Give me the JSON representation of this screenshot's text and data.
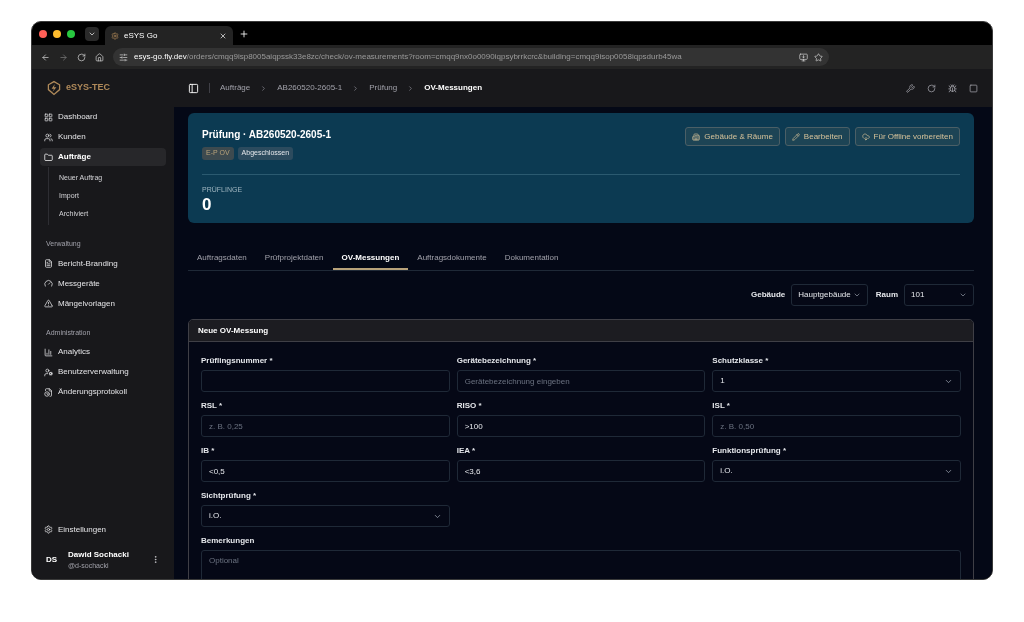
{
  "browser": {
    "tab_title": "eSYS Go",
    "url_host": "esys-go.fly.dev",
    "url_path": "/orders/cmqq9isp8005aiqpssk33e8zc/check/ov-measurements?room=cmqq9nx0o0090iqpsybrrkcrc&building=cmqq9isop0058iqpsdurb45wa"
  },
  "sidebar": {
    "logo": "eSYS-TEC",
    "items": [
      {
        "label": "Dashboard",
        "selected": false
      },
      {
        "label": "Kunden",
        "selected": false
      },
      {
        "label": "Aufträge",
        "selected": true,
        "children": [
          {
            "label": "Neuer Auftrag"
          },
          {
            "label": "Import"
          },
          {
            "label": "Archiviert"
          }
        ]
      }
    ],
    "sections": [
      {
        "title": "Verwaltung",
        "items": [
          {
            "label": "Bericht-Branding"
          },
          {
            "label": "Messgeräte"
          },
          {
            "label": "Mängelvorlagen"
          }
        ]
      },
      {
        "title": "Administration",
        "items": [
          {
            "label": "Analytics"
          },
          {
            "label": "Benutzerverwaltung"
          },
          {
            "label": "Änderungsprotokoll"
          }
        ]
      }
    ],
    "settings": "Einstellungen",
    "user": {
      "initials": "DS",
      "name": "Dawid Sochacki",
      "handle": "@d-sochacki"
    }
  },
  "breadcrumbs": [
    "Aufträge",
    "AB260520-2605-1",
    "Prüfung",
    "OV-Messungen"
  ],
  "header": {
    "title": "Prüfung · AB260520-2605-1",
    "badges": [
      "E-P OV",
      "Abgeschlossen"
    ],
    "buttons": [
      "Gebäude & Räume",
      "Bearbeiten",
      "Für Offline vorbereiten"
    ],
    "stat": {
      "label": "PRÜFLINGE",
      "value": "0"
    }
  },
  "tabs": [
    {
      "label": "Auftragsdaten",
      "selected": false
    },
    {
      "label": "Prüfprojektdaten",
      "selected": false
    },
    {
      "label": "OV-Messungen",
      "selected": true
    },
    {
      "label": "Auftragsdokumente",
      "selected": false
    },
    {
      "label": "Dokumentation",
      "selected": false
    }
  ],
  "filters": [
    {
      "label": "Gebäude",
      "value": "Hauptgebäude"
    },
    {
      "label": "Raum",
      "value": "101"
    }
  ],
  "form": {
    "title": "Neue OV-Messung",
    "fields": [
      {
        "label": "Prüflingsnummer *",
        "kind": "input"
      },
      {
        "label": "Gerätebezeichnung *",
        "kind": "input",
        "placeholder": "Gerätebezeichnung eingeben"
      },
      {
        "label": "Schutzklasse *",
        "kind": "select",
        "value": "1"
      },
      {
        "label": "RSL *",
        "kind": "input",
        "placeholder": "z. B. 0,25"
      },
      {
        "label": "RISO *",
        "kind": "input",
        "value": ">100"
      },
      {
        "label": "ISL *",
        "kind": "input",
        "placeholder": "z. B. 0,50"
      },
      {
        "label": "IB *",
        "kind": "input",
        "value": "<0,5"
      },
      {
        "label": "IEA *",
        "kind": "input",
        "value": "<3,6"
      },
      {
        "label": "Funktionsprüfung *",
        "kind": "select",
        "value": "i.O."
      },
      {
        "label": "Sichtprüfung *",
        "kind": "select",
        "value": "i.O."
      },
      {
        "label": "Bemerkungen",
        "kind": "textarea",
        "placeholder": "Optional"
      }
    ]
  }
}
